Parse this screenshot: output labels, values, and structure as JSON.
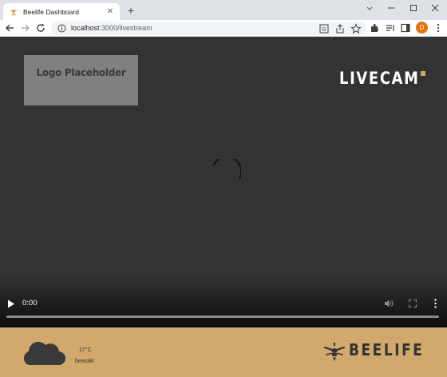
{
  "browser": {
    "tab_title": "Beelife Dashboard",
    "url_host": "localhost",
    "url_path": ":3000/livestream",
    "avatar_letter": "D",
    "avatar_color": "#e8710a"
  },
  "page": {
    "logo_placeholder": "Logo Placeholder",
    "livecam_title": "LIVECAM",
    "accent_color": "#d4a35e",
    "video": {
      "time": "0:00",
      "state": "loading"
    },
    "footer": {
      "background": "#d1a96c",
      "temperature": "17°C",
      "weather": "bewolkt",
      "brand": "BEELIFE",
      "weather_icon": "cloud-icon",
      "brand_icon": "bee-icon"
    }
  }
}
